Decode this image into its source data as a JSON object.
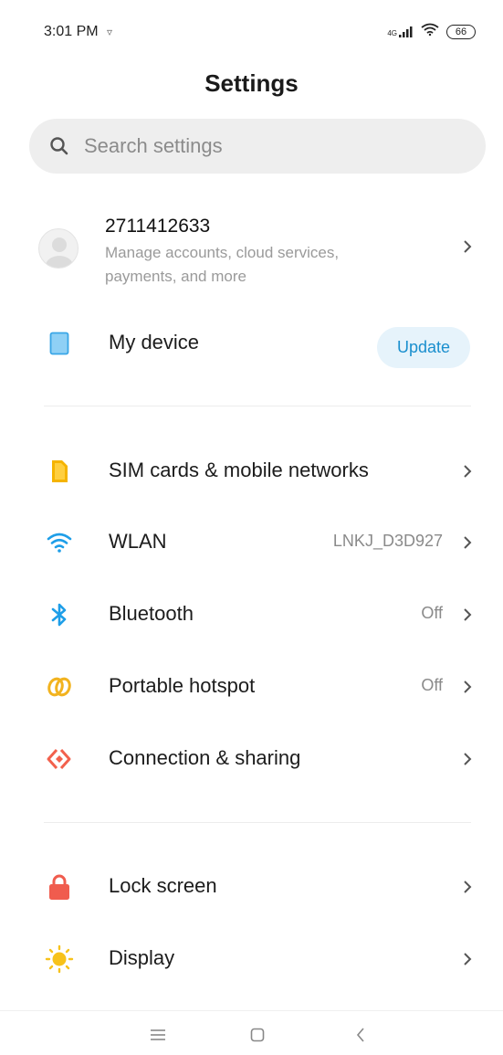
{
  "status_bar": {
    "time": "3:01 PM",
    "network": "4G",
    "battery": "66"
  },
  "header": {
    "title": "Settings"
  },
  "search": {
    "placeholder": "Search settings"
  },
  "account": {
    "id": "2711412633",
    "subtitle": "Manage accounts, cloud services, payments, and more"
  },
  "device": {
    "label": "My device",
    "update_label": "Update"
  },
  "network_items": [
    {
      "label": "SIM cards & mobile networks",
      "value": "",
      "icon": "sim-card-icon"
    },
    {
      "label": "WLAN",
      "value": "LNKJ_D3D927",
      "icon": "wifi-icon"
    },
    {
      "label": "Bluetooth",
      "value": "Off",
      "icon": "bluetooth-icon"
    },
    {
      "label": "Portable hotspot",
      "value": "Off",
      "icon": "hotspot-icon"
    },
    {
      "label": "Connection & sharing",
      "value": "",
      "icon": "connection-sharing-icon"
    }
  ],
  "system_items": [
    {
      "label": "Lock screen",
      "icon": "lock-icon"
    },
    {
      "label": "Display",
      "icon": "sun-icon"
    }
  ],
  "colors": {
    "accent": "#1a8fce",
    "sim": "#f5b400",
    "wifi": "#1e9ee8",
    "hotspot": "#f2b31f",
    "sharing": "#f2614d",
    "lock": "#f05c4e",
    "display": "#f7c21b"
  }
}
